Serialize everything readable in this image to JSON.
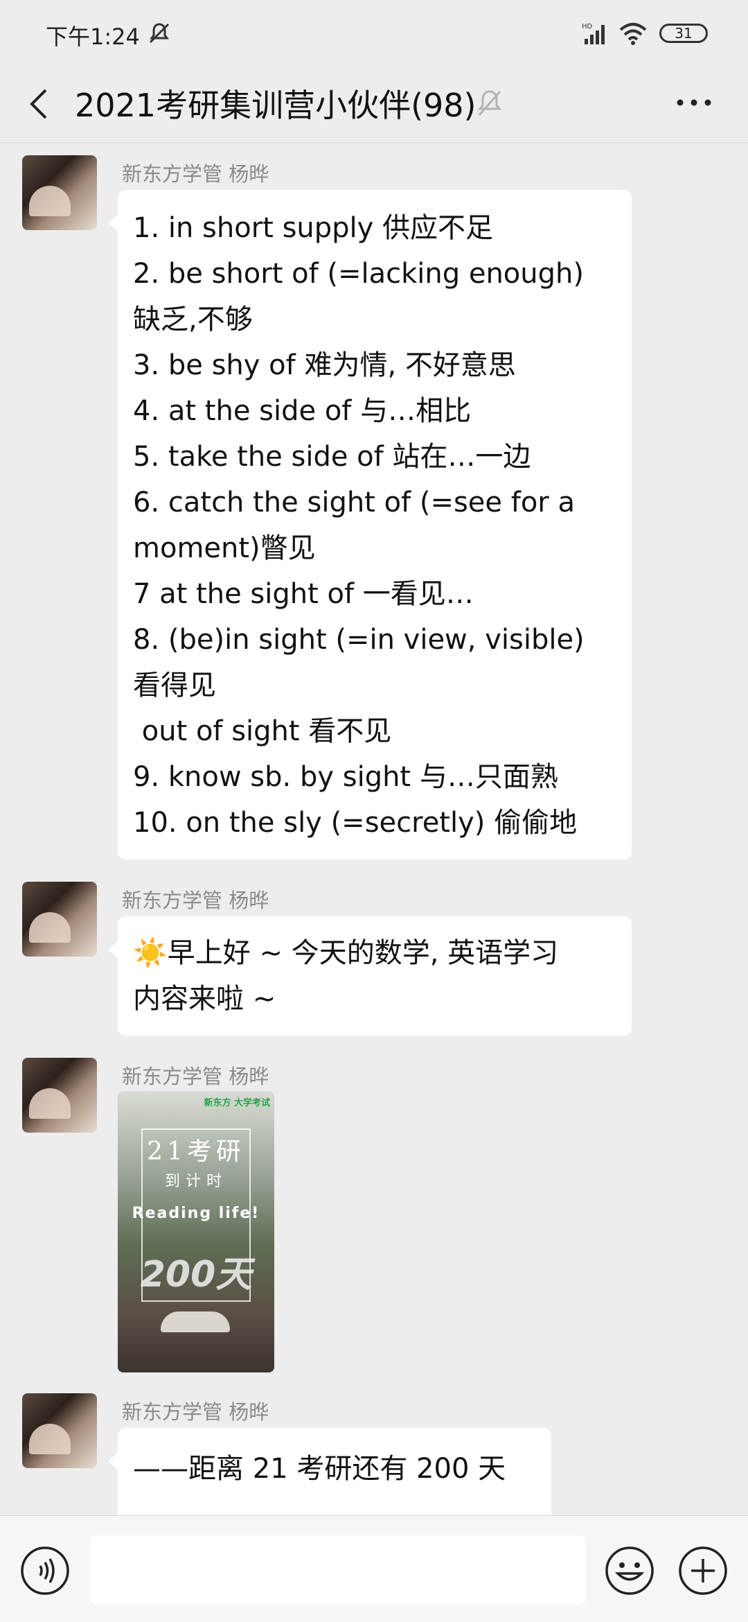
{
  "status_bar": {
    "time": "下午1:24",
    "battery": "31"
  },
  "header": {
    "title": "2021考研集训营小伙伴(98)"
  },
  "messages": [
    {
      "sender": "新东方学管  杨晔",
      "lines": [
        "1. in short supply 供应不足",
        "2. be short of (=lacking enough)",
        "缺乏,不够",
        "3. be shy of 难为情, 不好意思",
        "4. at the side of 与…相比",
        "5. take the side of 站在…一边",
        "6. catch the sight of (=see for a",
        "moment)瞥见",
        "7 at the sight of 一看见…",
        "8. (be)in sight (=in view, visible)",
        "看得见",
        " out of sight 看不见",
        "9. know sb. by sight 与…只面熟",
        "10. on the sly (=secretly) 偷偷地"
      ]
    },
    {
      "sender": "新东方学管  杨晔",
      "lines": [
        "☀️早上好 ~ 今天的数学, 英语学习",
        "内容来啦 ~"
      ]
    },
    {
      "sender": "新东方学管  杨晔",
      "image": {
        "logo": "新东方 大学考试",
        "title": "21考研",
        "subtitle": "到计时",
        "tagline": "Reading life!",
        "days": "200天"
      }
    },
    {
      "sender": "新东方学管  杨晔",
      "lines": [
        "——距离 21 考研还有 200 天"
      ]
    }
  ],
  "colors": {
    "background": "#ededed",
    "bubble": "#ffffff",
    "sender": "#8a8a8a"
  },
  "icons": [
    "mute-icon",
    "signal-icon",
    "wifi-icon",
    "back-icon",
    "bell-off-icon",
    "more-icon",
    "voice-icon",
    "emoji-icon",
    "plus-icon"
  ]
}
